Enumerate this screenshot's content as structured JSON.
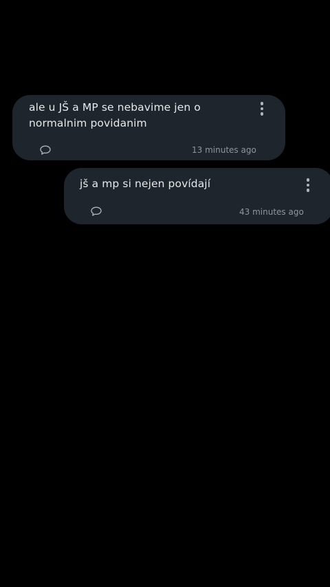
{
  "messages": [
    {
      "text": "ale u JŠ a MP se nebavime jen o normalnim povidanim",
      "time": "13 minutes ago",
      "comment_icon": "comment-bubble-icon",
      "menu_icon": "more-vertical-icon"
    },
    {
      "text": "jš a mp si nejen povídají",
      "time": "43 minutes ago",
      "comment_icon": "comment-bubble-icon",
      "menu_icon": "more-vertical-icon"
    }
  ],
  "colors": {
    "background": "#000000",
    "card": "#1e252d",
    "text": "#e6e8ea",
    "muted": "#8f969c"
  }
}
